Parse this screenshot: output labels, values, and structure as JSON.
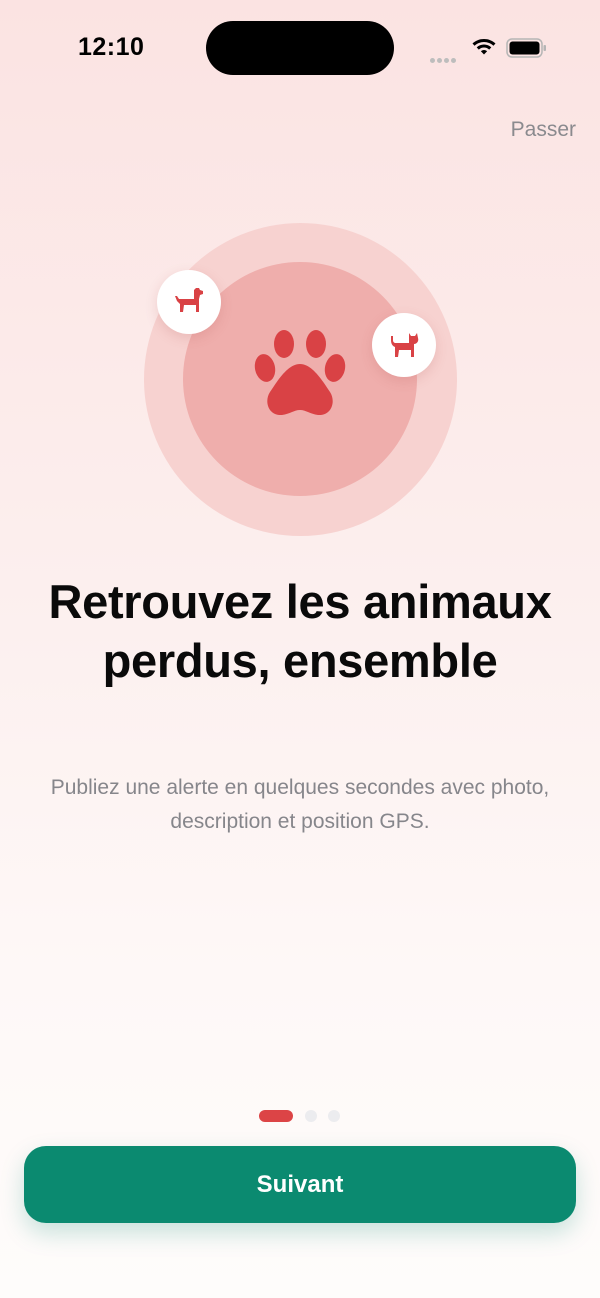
{
  "status_bar": {
    "time": "12:10"
  },
  "skip_label": "Passer",
  "illustration": {
    "center_icon": "paw-icon",
    "left_badge_icon": "dog-icon",
    "right_badge_icon": "cat-icon"
  },
  "headline": "Retrouvez les animaux perdus, ensemble",
  "subtitle": "Publiez une alerte en quelques secondes avec photo, description et position GPS.",
  "pagination": {
    "total": 3,
    "active_index": 0
  },
  "next_label": "Suivant",
  "colors": {
    "accent": "#dc4446",
    "primary_button": "#0b8a70",
    "muted_text": "#86868b"
  }
}
